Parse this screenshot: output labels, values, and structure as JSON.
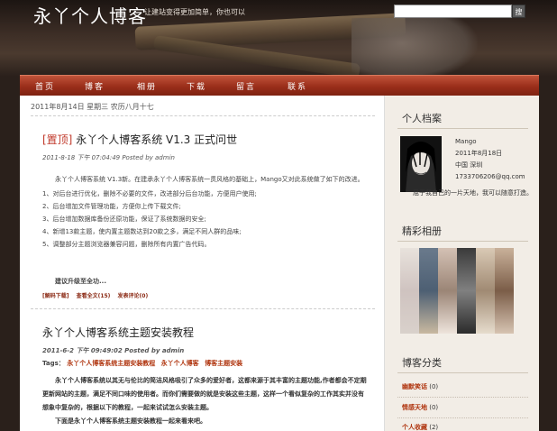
{
  "header": {
    "site_title": "永丫个人博客",
    "site_desc": "让建站变得更加简单，你也可以",
    "search_button": "搜"
  },
  "nav": [
    "首页",
    "博客",
    "相册",
    "下载",
    "留言",
    "联系"
  ],
  "date_line": "2011年8月14日 星期三 农历八月十七",
  "post1": {
    "pin": "[置顶]",
    "title": " 永丫个人博客系统 V1.3 正式问世",
    "meta": "2011-8-18 下午 07:04:49  Posted by admin",
    "intro": "永丫个人博客系统  V1.3新。在建承永丫个人博客系统一贯风格的基础上，Mango又对此系统做了如下的改进。",
    "items": [
      "1、对后台进行优化，删除不必要的文件，改进部分后台功能，方便用户使用;",
      "2、后台增加文件管理功能，方便你上传下载文件;",
      "3、后台增加数据库备份还原功能，保证了系统数据的安全;",
      "4、新增13款主题，使内置主题数达到20款之多，满足不同人群的品味;",
      "5、调整部分主题浏览器兼容问题，删除所有内置广告代码。"
    ],
    "upgrade": "建议升级至全功...",
    "links": [
      "[解码下载]",
      "查看全文(15)",
      "发表评论(0)"
    ]
  },
  "post2": {
    "title": "永丫个人博客系统主题安装教程",
    "meta": "2011-6-2 下午 09:49:02  Posted by admin",
    "tags_label": "Tags：",
    "tags": [
      "永丫个人博客系统主题安装教程",
      "永丫个人博客",
      "博客主题安装"
    ],
    "para1": "永丫个人博客系统以其无与伦比的简洁风格吸引了众多的爱好者，这都来源于其丰富的主题功能,作者都会不定期更新网站的主题，满足不同口味的使用者。而你们需要做的就是安装这些主题，这样一个看似复杂的工作其实并没有想象中复杂的，根据以下的教程，一起来试试怎么安装主题。",
    "para2": "下面是永丫个人博客系统主题安装教程一起来看来吧。"
  },
  "sidebar": {
    "profile_title": "个人档案",
    "name": "Mango",
    "date": "2011年8月18日",
    "location": "中国  深圳",
    "email": "1733706206@qq.com",
    "bio": "屈于我自己的一片天地，我可以随意打造。",
    "album_title": "精彩相册",
    "category_title": "博客分类",
    "categories": [
      {
        "name": "幽默笑话",
        "count": "(0)"
      },
      {
        "name": "情感天地",
        "count": "(0)"
      },
      {
        "name": "个人收藏",
        "count": "(2)"
      }
    ]
  },
  "colors": {
    "nav": "#9a2e1a",
    "accent": "#b0350f",
    "background": "#2a201b",
    "sidebar": "#f2ede6"
  }
}
